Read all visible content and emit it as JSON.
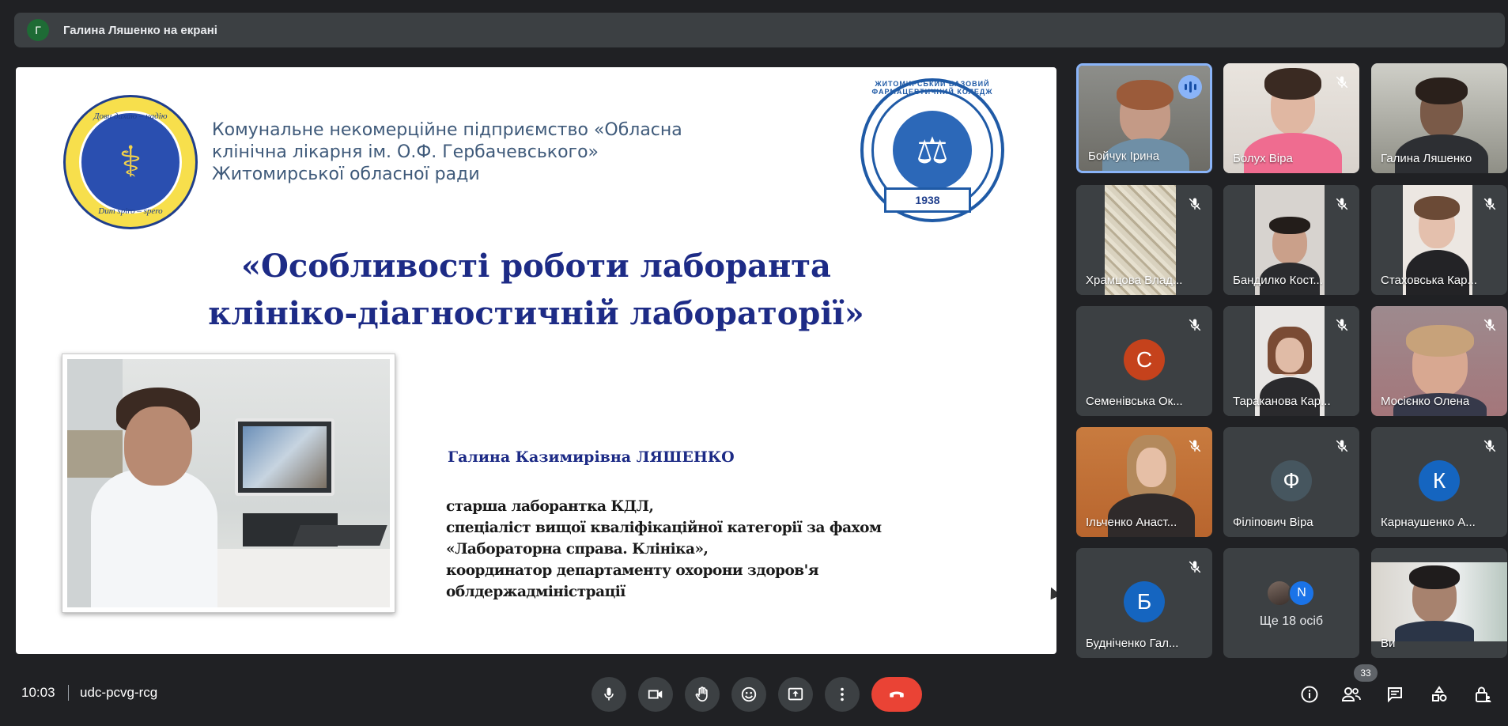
{
  "presenter": {
    "initial": "Г",
    "text": "Галина Ляшенко на екрані"
  },
  "slide": {
    "seal_top_text": "Дови дихаю – надію",
    "seal_bottom_text": "Dum spiro – spero",
    "hospital_lines": [
      "Комунальне некомерційне підприємство «Обласна",
      "клінічна лікарня ім. О.Ф. Гербачевського»",
      "Житомирської обласної ради"
    ],
    "college_arc_text": "ЖИТОМИРСЬКИЙ БАЗОВИЙ ФАРМАЦЕВТИЧНИЙ КОЛЕДЖ",
    "college_year": "1938",
    "title_lines": [
      "«Особливості роботи лаборанта",
      "клініко-діагностичній лабораторії»"
    ],
    "person_name": "Галина Казимирівна ЛЯШЕНКО",
    "person_desc": [
      "старша лаборантка КДЛ,",
      " спеціаліст вищої кваліфікаційної категорії за фахом",
      "«Лабораторна справа. Клініка»,",
      " координатор департаменту охорони здоров'я",
      "облдержадміністрації"
    ]
  },
  "participants": [
    {
      "name": "Бойчук Ірина",
      "mic": "speaking",
      "kind": "video"
    },
    {
      "name": "Болух Віра",
      "mic": "muted",
      "kind": "video"
    },
    {
      "name": "Галина Ляшенко",
      "mic": "none",
      "kind": "video"
    },
    {
      "name": "Храмцова Влад...",
      "mic": "muted",
      "kind": "video"
    },
    {
      "name": "Бандилко Кост...",
      "mic": "muted",
      "kind": "video"
    },
    {
      "name": "Стаховська Кар...",
      "mic": "muted",
      "kind": "video"
    },
    {
      "name": "Семенівська Ок...",
      "mic": "muted",
      "kind": "avatar",
      "initial": "С",
      "color": "#c5421c"
    },
    {
      "name": "Тараканова Кар...",
      "mic": "muted",
      "kind": "video"
    },
    {
      "name": "Мосієнко Олена",
      "mic": "muted",
      "kind": "video"
    },
    {
      "name": "Ільченко Анаст...",
      "mic": "muted",
      "kind": "video"
    },
    {
      "name": "Філіпович Віра",
      "mic": "muted",
      "kind": "avatar",
      "initial": "Ф",
      "color": "#46565f"
    },
    {
      "name": "Карнаушенко А...",
      "mic": "muted",
      "kind": "avatar",
      "initial": "К",
      "color": "#1565c0"
    },
    {
      "name": "Будніченко Гал...",
      "mic": "muted",
      "kind": "avatar",
      "initial": "Б",
      "color": "#1565c0"
    },
    {
      "name": "",
      "kind": "more",
      "more_initial": "N",
      "more_text": "Ще 18 осіб"
    },
    {
      "name": "Ви",
      "mic": "none",
      "kind": "video"
    }
  ],
  "bottom": {
    "time": "10:03",
    "meeting_code": "udc-pcvg-rcg",
    "participant_count": "33"
  },
  "colors": {
    "background": "#202124",
    "tile": "#3c4043",
    "hangup": "#ea4335",
    "active_border": "#8ab4f8",
    "title_blue": "#1d2b86"
  }
}
